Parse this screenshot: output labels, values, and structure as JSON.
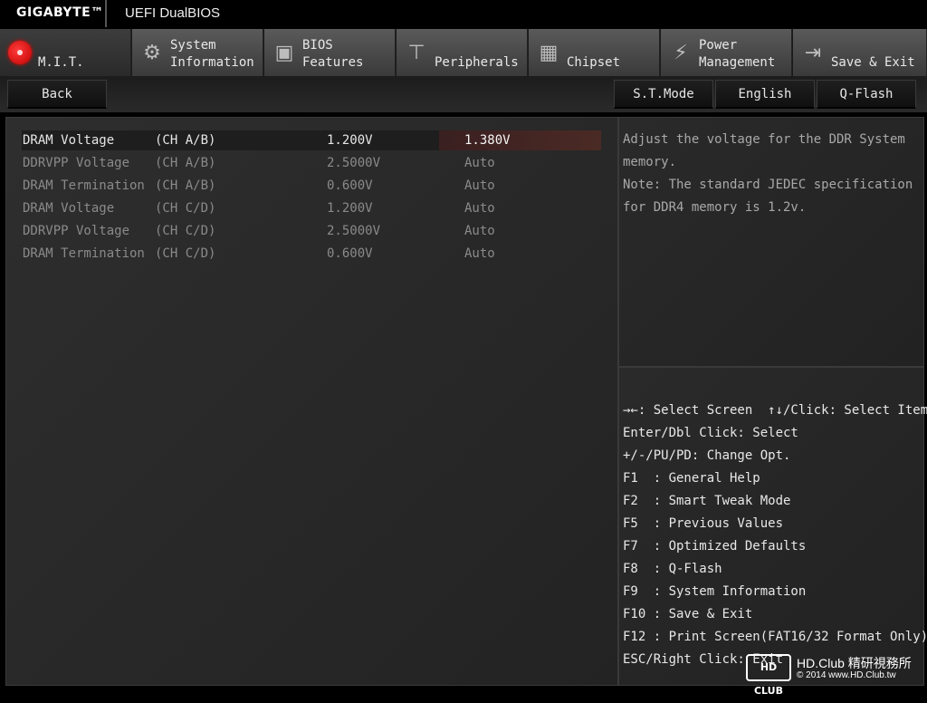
{
  "header": {
    "brand": "GIGABYTE™",
    "product": "UEFI DualBIOS"
  },
  "tabs": [
    {
      "line1": "",
      "line2": "M.I.T.",
      "icon": "mit-red-dot-icon",
      "active": true
    },
    {
      "line1": "System",
      "line2": "Information",
      "icon": "gear-icon"
    },
    {
      "line1": "BIOS",
      "line2": "Features",
      "icon": "bios-chip-icon"
    },
    {
      "line1": "",
      "line2": "Peripherals",
      "icon": "peripherals-icon"
    },
    {
      "line1": "",
      "line2": "Chipset",
      "icon": "chipset-icon"
    },
    {
      "line1": "Power",
      "line2": "Management",
      "icon": "power-bolt-icon"
    },
    {
      "line1": "",
      "line2": "Save & Exit",
      "icon": "exit-icon"
    }
  ],
  "toolbar": {
    "back": "Back",
    "st_mode": "S.T.Mode",
    "language": "English",
    "qflash": "Q-Flash"
  },
  "settings": [
    {
      "name": "DRAM Voltage",
      "channel": "(CH A/B)",
      "current": "1.200V",
      "value": "1.380V"
    },
    {
      "name": "DDRVPP Voltage",
      "channel": "(CH A/B)",
      "current": "2.5000V",
      "value": "Auto"
    },
    {
      "name": "DRAM Termination",
      "channel": "(CH A/B)",
      "current": "0.600V",
      "value": "Auto"
    },
    {
      "name": "DRAM Voltage",
      "channel": "(CH C/D)",
      "current": "1.200V",
      "value": "Auto"
    },
    {
      "name": "DDRVPP Voltage",
      "channel": "(CH C/D)",
      "current": "2.5000V",
      "value": "Auto"
    },
    {
      "name": "DRAM Termination",
      "channel": "(CH C/D)",
      "current": "0.600V",
      "value": "Auto"
    }
  ],
  "help": {
    "text": "Adjust the voltage for the DDR System\nmemory.\nNote: The standard JEDEC specification\nfor DDR4 memory is 1.2v."
  },
  "keys": [
    "→←: Select Screen  ↑↓/Click: Select Item",
    "Enter/Dbl Click: Select",
    "+/-/PU/PD: Change Opt.",
    "F1  : General Help",
    "F2  : Smart Tweak Mode",
    "F5  : Previous Values",
    "F7  : Optimized Defaults",
    "F8  : Q-Flash",
    "F9  : System Information",
    "F10 : Save & Exit",
    "F12 : Print Screen(FAT16/32 Format Only)",
    "ESC/Right Click: Exit"
  ],
  "watermark": {
    "logo": "HD CLUB",
    "line1": "HD.Club 精研視務所",
    "line2": "© 2014  www.HD.Club.tw"
  }
}
